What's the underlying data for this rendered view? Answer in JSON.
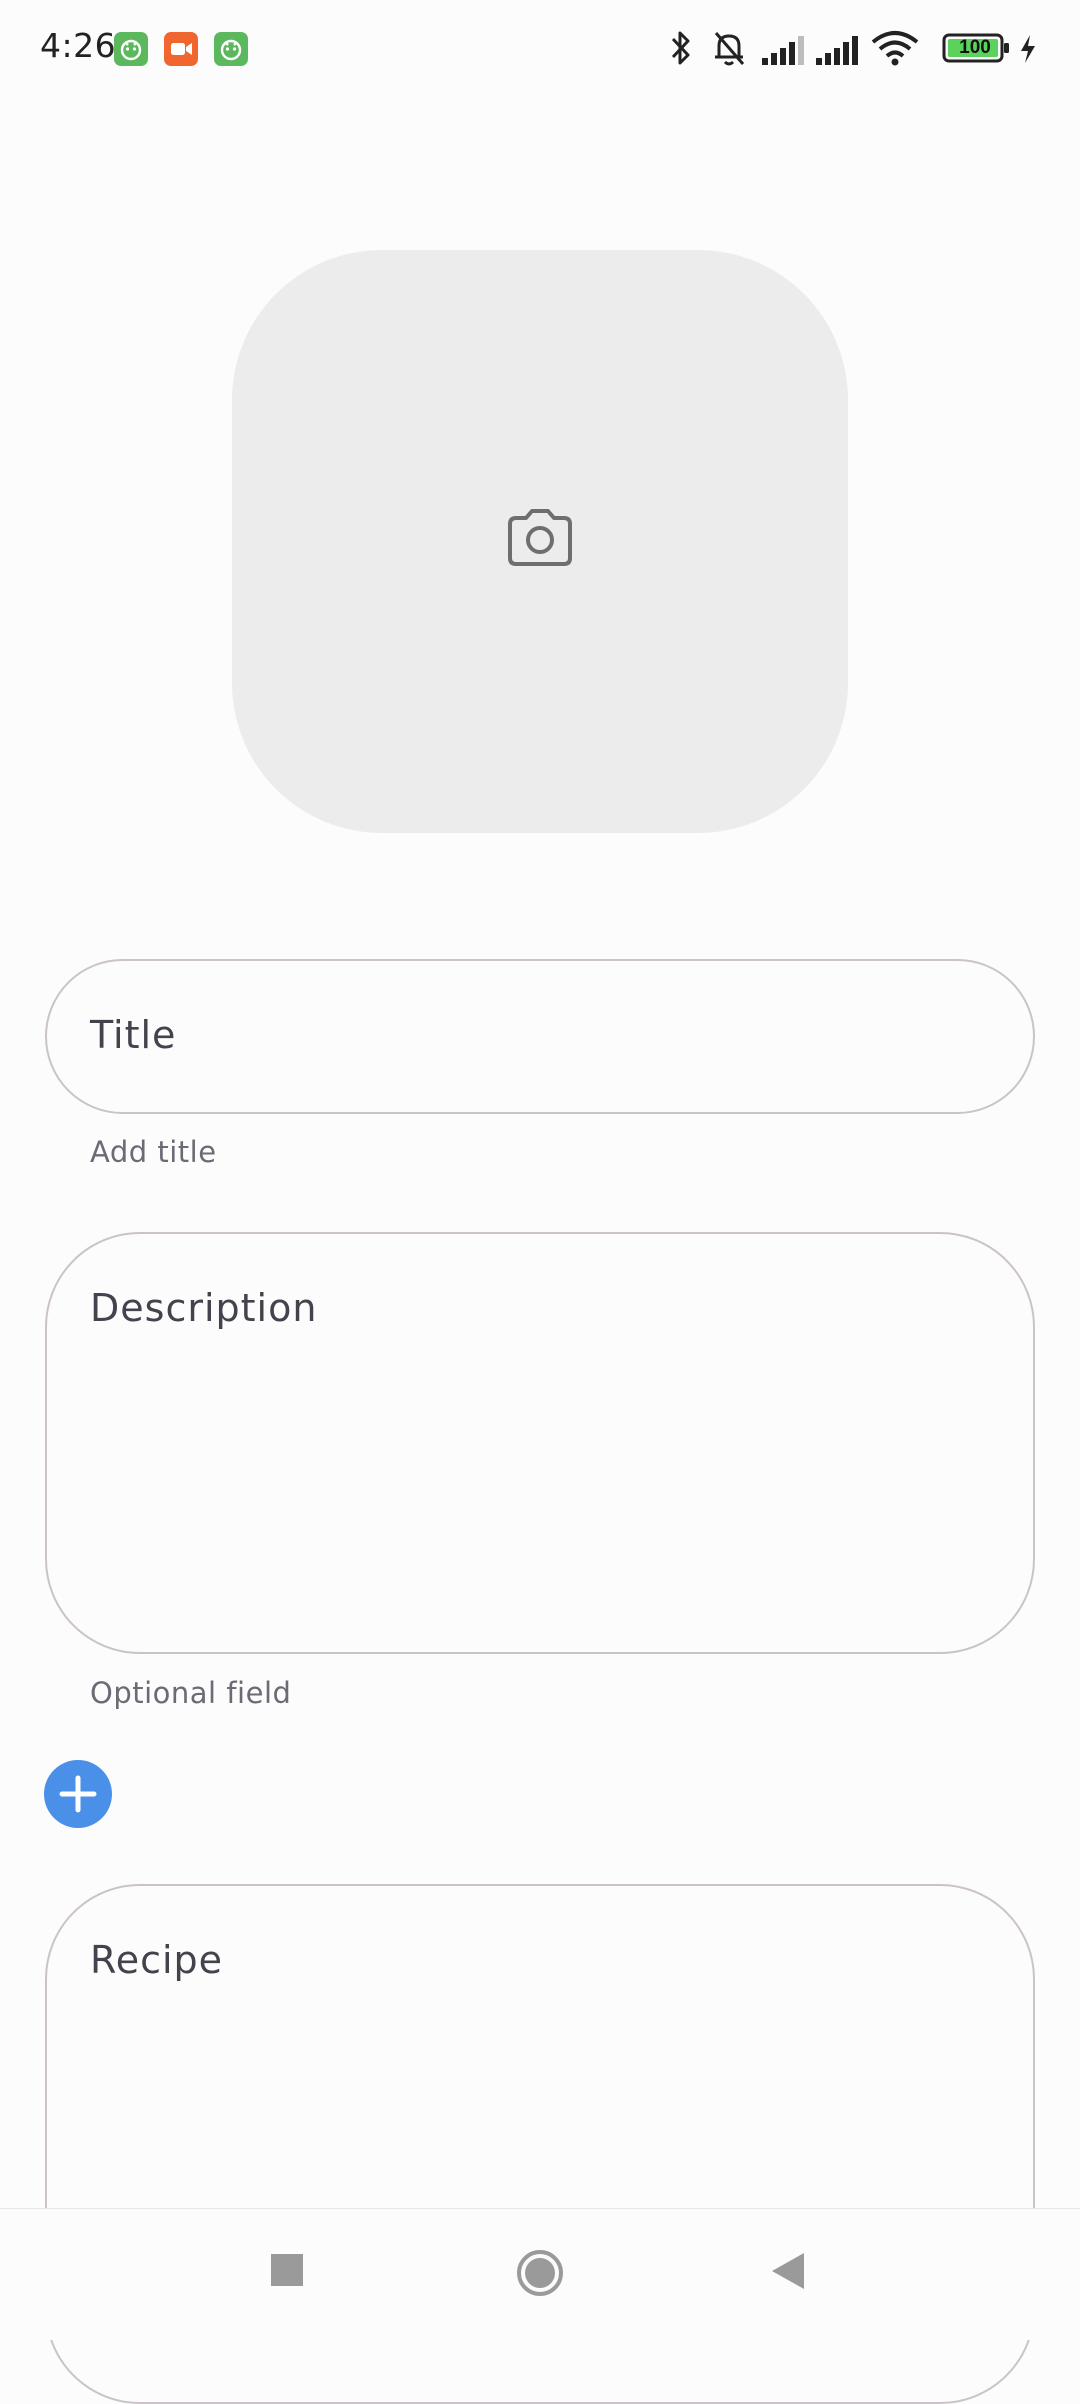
{
  "status_bar": {
    "time": "4:26",
    "battery_level": "100",
    "icons": [
      "bluetooth-icon",
      "bell-off-icon",
      "signal-icon",
      "signal-icon",
      "wifi-icon",
      "battery-icon",
      "charging-icon"
    ]
  },
  "photo_picker": {
    "icon": "camera-icon"
  },
  "title_field": {
    "label": "Title",
    "helper": "Add title"
  },
  "description_field": {
    "label": "Description",
    "helper": "Optional field"
  },
  "add_button": {
    "icon": "plus-icon",
    "color": "#4a90e8"
  },
  "recipe_field": {
    "label": "Recipe"
  },
  "nav_bar": {
    "icons": [
      "recents-icon",
      "home-icon",
      "back-icon"
    ]
  },
  "colors": {
    "background": "#fcfcfc",
    "field_border": "#cbc3c8",
    "photo_placeholder": "#ececec",
    "accent": "#4a90e8"
  }
}
